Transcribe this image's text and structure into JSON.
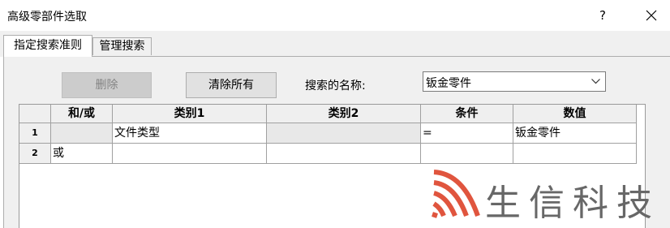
{
  "window": {
    "title": "高级零部件选取",
    "help_label": "?"
  },
  "tabs": [
    {
      "label": "指定搜索准则",
      "active": true
    },
    {
      "label": "管理搜索",
      "active": false
    }
  ],
  "toolbar": {
    "delete_label": "删除",
    "delete_enabled": false,
    "clear_all_label": "清除所有"
  },
  "search": {
    "name_label": "搜索的名称:",
    "selected_value": "钣金零件"
  },
  "grid": {
    "headers": [
      "和/或",
      "类别1",
      "类别2",
      "条件",
      "数值"
    ],
    "rows": [
      {
        "row_no": "1",
        "and_or": "",
        "category1": "文件类型",
        "category2": "",
        "condition": "=",
        "value": "钣金零件"
      },
      {
        "row_no": "2",
        "and_or": "或",
        "category1": "",
        "category2": "",
        "condition": "",
        "value": ""
      }
    ]
  },
  "watermark": {
    "text": "生信科技",
    "logo_color": "#e0553e",
    "text_color": "#676767"
  }
}
